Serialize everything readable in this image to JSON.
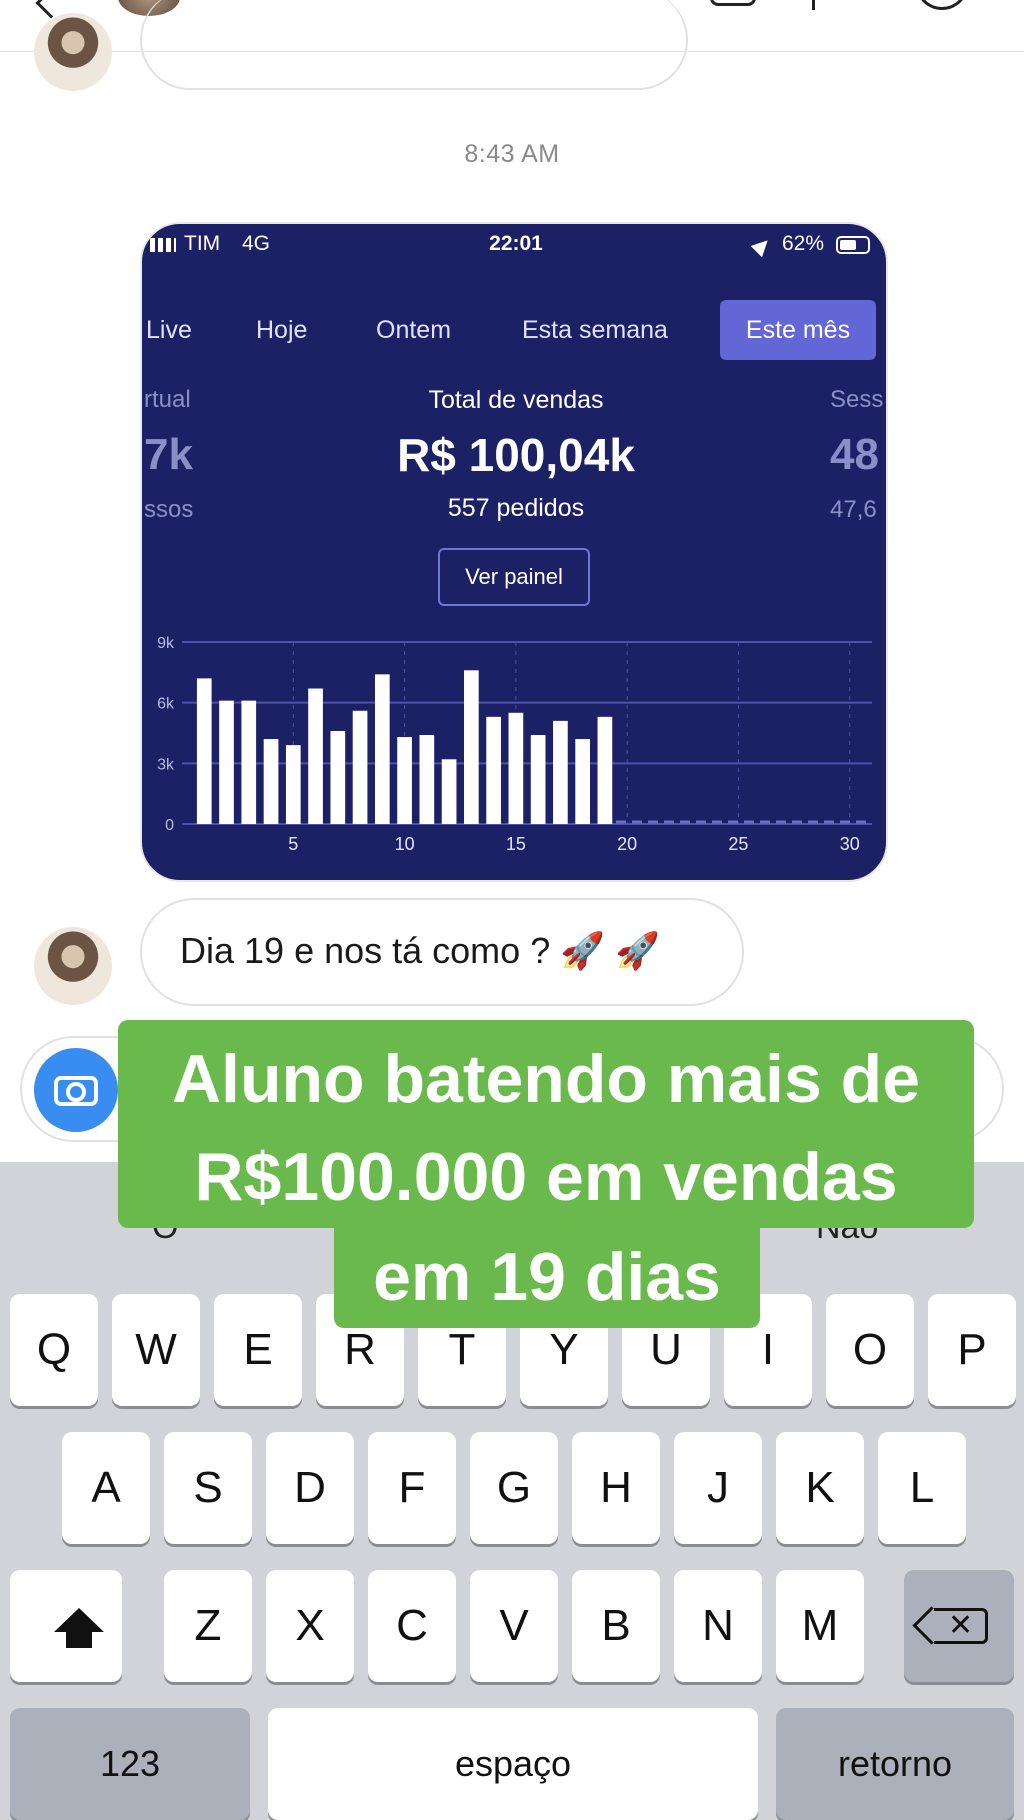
{
  "chat": {
    "timestamp": "8:43 AM",
    "message": "Dia 19 e nos tá como ? 🚀 🚀"
  },
  "shared_screenshot": {
    "status_bar": {
      "carrier": "TIM",
      "network": "4G",
      "time": "22:01",
      "battery": "62%"
    },
    "tabs": [
      "Live",
      "Hoje",
      "Ontem",
      "Esta semana",
      "Este mês"
    ],
    "selected_tab": "Este mês",
    "left_metric": {
      "label": "rtual",
      "value": "7k",
      "sub": "ssos"
    },
    "main_metric": {
      "label": "Total de vendas",
      "value": "R$ 100,04k",
      "sub": "557 pedidos"
    },
    "right_metric": {
      "label": "Sess",
      "value": "48",
      "sub": "47,6"
    },
    "button_label": "Ver painel",
    "colors": {
      "background": "#1c2166",
      "tab_active": "#6367d6",
      "bar": "#ffffff"
    }
  },
  "chart_data": {
    "type": "bar",
    "x": [
      1,
      2,
      3,
      4,
      5,
      6,
      7,
      8,
      9,
      10,
      11,
      12,
      13,
      14,
      15,
      16,
      17,
      18,
      19
    ],
    "values": [
      7.2,
      6.1,
      6.1,
      4.2,
      3.9,
      6.7,
      4.6,
      5.6,
      7.4,
      4.3,
      4.4,
      3.2,
      7.6,
      5.3,
      5.5,
      4.4,
      5.1,
      4.2,
      5.3
    ],
    "xticks": [
      "5",
      "10",
      "15",
      "20",
      "25",
      "30"
    ],
    "yticks": [
      "0",
      "3k",
      "6k",
      "9k"
    ],
    "ylim": [
      0,
      9
    ],
    "xlim": [
      0,
      31
    ],
    "grid": true
  },
  "composer": {
    "icon": "camera-icon"
  },
  "keyboard": {
    "suggestions": [
      "O",
      "Não"
    ],
    "row1": [
      "Q",
      "W",
      "E",
      "R",
      "T",
      "Y",
      "U",
      "I",
      "O",
      "P"
    ],
    "row2": [
      "A",
      "S",
      "D",
      "F",
      "G",
      "H",
      "J",
      "K",
      "L"
    ],
    "row3": [
      "Z",
      "X",
      "C",
      "V",
      "B",
      "N",
      "M"
    ],
    "numbers_label": "123",
    "space_label": "espaço",
    "return_label": "retorno"
  },
  "overlay": {
    "line1": "Aluno batendo mais de",
    "line2": "R$100.000 em vendas",
    "line3": "em 19 dias",
    "color": "#6ab94d"
  }
}
